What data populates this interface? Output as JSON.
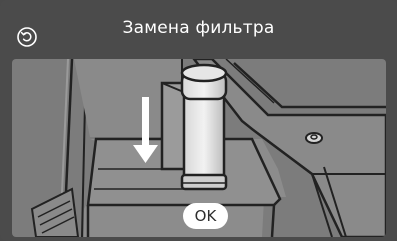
{
  "header": {
    "title": "Замена фильтра",
    "back_icon": "undo-icon"
  },
  "illustration": {
    "subject": "water filter being inserted into coffee machine water tank",
    "arrow_icon": "down-arrow-icon"
  },
  "actions": {
    "ok_label": "OK"
  },
  "colors": {
    "background": "#4b4b4b",
    "panel": "#7c7c7c",
    "text": "#ffffff"
  }
}
